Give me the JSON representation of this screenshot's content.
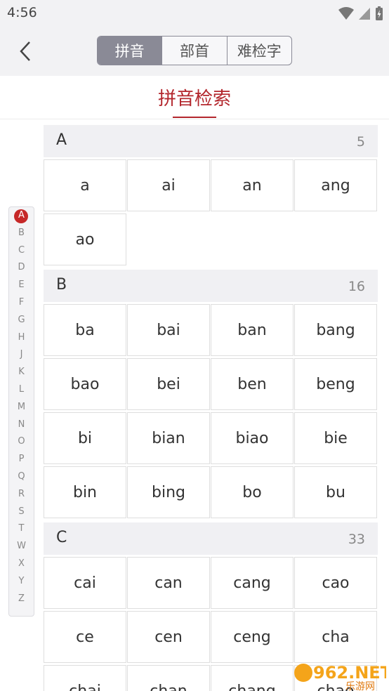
{
  "status": {
    "time": "4:56"
  },
  "toolbar": {
    "tabs": [
      {
        "label": "拼音",
        "active": true
      },
      {
        "label": "部首",
        "active": false
      },
      {
        "label": "难检字",
        "active": false
      }
    ]
  },
  "page": {
    "title": "拼音检索"
  },
  "index": {
    "letters": [
      "A",
      "B",
      "C",
      "D",
      "E",
      "F",
      "G",
      "H",
      "J",
      "K",
      "L",
      "M",
      "N",
      "O",
      "P",
      "Q",
      "R",
      "S",
      "T",
      "W",
      "X",
      "Y",
      "Z"
    ],
    "active": "A"
  },
  "sections": [
    {
      "letter": "A",
      "count": "5",
      "items": [
        "a",
        "ai",
        "an",
        "ang",
        "ao"
      ]
    },
    {
      "letter": "B",
      "count": "16",
      "items": [
        "ba",
        "bai",
        "ban",
        "bang",
        "bao",
        "bei",
        "ben",
        "beng",
        "bi",
        "bian",
        "biao",
        "bie",
        "bin",
        "bing",
        "bo",
        "bu"
      ]
    },
    {
      "letter": "C",
      "count": "33",
      "items": [
        "cai",
        "can",
        "cang",
        "cao",
        "ce",
        "cen",
        "ceng",
        "cha",
        "chai",
        "chan",
        "chang",
        "chao"
      ]
    }
  ],
  "watermark": {
    "text": "962.NET",
    "sub": "乐游网"
  },
  "colors": {
    "accent": "#b3262c",
    "segment": "#8a8a96"
  }
}
